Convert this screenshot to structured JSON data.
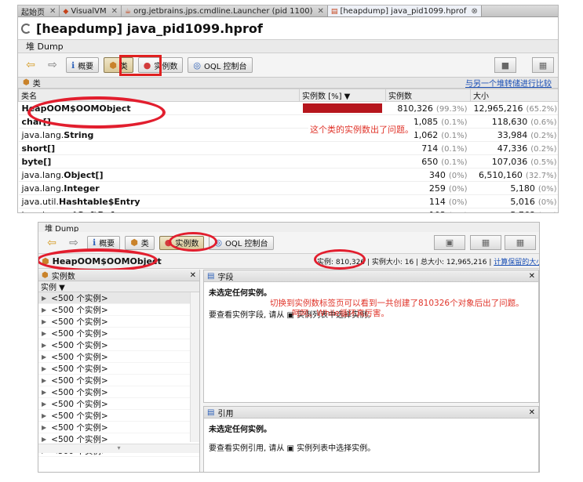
{
  "top": {
    "tabs": [
      {
        "label": "起始页"
      },
      {
        "label": "VisualVM"
      },
      {
        "label": "org.jetbrains.jps.cmdline.Launcher (pid 1100)"
      },
      {
        "label": "[heapdump] java_pid1099.hprof"
      }
    ],
    "title": "[heapdump] java_pid1099.hprof",
    "dump_label": "堆 Dump",
    "toolbar": {
      "summary": "概要",
      "classes": "类",
      "instances": "实例数",
      "oql": "OQL 控制台"
    },
    "classes_header": "类",
    "compare_link": "与另一个堆转储进行比较",
    "columns": {
      "name": "类名",
      "instances_pct": "实例数 [%] ▼",
      "instances": "实例数",
      "size": "大小"
    },
    "rows": [
      {
        "name_prefix": "",
        "name_bold": "HeapOOM$OOMObject",
        "instances": "810,326",
        "inst_pct": "(99.3%)",
        "size": "12,965,216",
        "size_pct": "(65.2%)",
        "bar_pct": 99.3
      },
      {
        "name_prefix": "",
        "name_bold": "char[]",
        "instances": "1,085",
        "inst_pct": "(0.1%)",
        "size": "118,630",
        "size_pct": "(0.6%)",
        "bar_pct": 0.1
      },
      {
        "name_prefix": "java.lang.",
        "name_bold": "String",
        "instances": "1,062",
        "inst_pct": "(0.1%)",
        "size": "33,984",
        "size_pct": "(0.2%)",
        "bar_pct": 0.1
      },
      {
        "name_prefix": "",
        "name_bold": "short[]",
        "instances": "714",
        "inst_pct": "(0.1%)",
        "size": "47,336",
        "size_pct": "(0.2%)",
        "bar_pct": 0.1
      },
      {
        "name_prefix": "",
        "name_bold": "byte[]",
        "instances": "650",
        "inst_pct": "(0.1%)",
        "size": "107,036",
        "size_pct": "(0.5%)",
        "bar_pct": 0.1
      },
      {
        "name_prefix": "java.lang.",
        "name_bold": "Object[]",
        "instances": "340",
        "inst_pct": "(0%)",
        "size": "6,510,160",
        "size_pct": "(32.7%)",
        "bar_pct": 0
      },
      {
        "name_prefix": "java.lang.",
        "name_bold": "Integer",
        "instances": "259",
        "inst_pct": "(0%)",
        "size": "5,180",
        "size_pct": "(0%)",
        "bar_pct": 0
      },
      {
        "name_prefix": "java.util.",
        "name_bold": "Hashtable$Entry",
        "instances": "114",
        "inst_pct": "(0%)",
        "size": "5,016",
        "size_pct": "(0%)",
        "bar_pct": 0
      },
      {
        "name_prefix": "java.lang.ref.",
        "name_bold": "SoftReference",
        "instances": "103",
        "inst_pct": "(0%)",
        "size": "5,768",
        "size_pct": "(0%)",
        "bar_pct": 0
      }
    ],
    "annotation": "这个类的实例数出了问题。"
  },
  "bottom": {
    "dump_label": "堆 Dump",
    "toolbar": {
      "summary": "概要",
      "classes": "类",
      "instances": "实例数",
      "oql": "OQL 控制台"
    },
    "class_name": "HeapOOM$OOMObject",
    "stats": {
      "instances": "实例: 810,326",
      "inst_size": "实例大小: 16",
      "total": "总大小: 12,965,216",
      "retained_link": "计算保留的大小"
    },
    "instances_pane": {
      "title": "实例数",
      "col": "实例 ▼",
      "items": [
        "<500 个实例>",
        "<500 个实例>",
        "<500 个实例>",
        "<500 个实例>",
        "<500 个实例>",
        "<500 个实例>",
        "<500 个实例>",
        "<500 个实例>",
        "<500 个实例>",
        "<500 个实例>",
        "<500 个实例>",
        "<500 个实例>",
        "<500 个实例>",
        "<500 个实例>"
      ]
    },
    "fields_pane": {
      "title": "字段",
      "no_sel": "未选定任何实例。",
      "annotation_line1": "切换到实例数标签页可以看到一共创建了810326个对象后出了问题。",
      "annotation_line2": "呵呵。While循环真厉害。",
      "hint": "要查看实例字段, 请从 ▣ 实例列表中选择实例。"
    },
    "refs_pane": {
      "title": "引用",
      "no_sel": "未选定任何实例。",
      "hint": "要查看实例引用, 请从 ▣ 实例列表中选择实例。"
    }
  }
}
